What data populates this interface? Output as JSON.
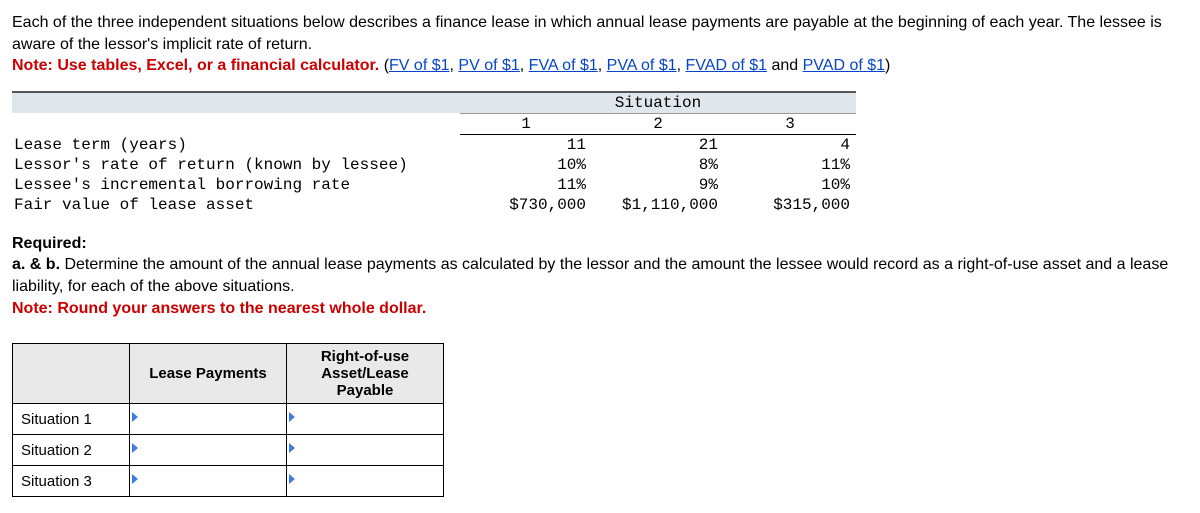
{
  "intro": {
    "line1": "Each of the three independent situations below describes a finance lease in which annual lease payments are payable at the beginning of each year. The lessee is aware of the lessor's implicit rate of return.",
    "note_label": "Note: Use tables, Excel, or a financial calculator.",
    "links": {
      "fv": "FV of $1",
      "pv": "PV of $1",
      "fva": "FVA of $1",
      "pva": "PVA of $1",
      "fvad": "FVAD of $1",
      "pvad": "PVAD of $1"
    },
    "and": " and ",
    "open": " (",
    "sep": ", ",
    "close": ")"
  },
  "sit_table": {
    "super_head": "Situation",
    "col1": "1",
    "col2": "2",
    "col3": "3",
    "rows": {
      "term": {
        "label": "Lease term (years)",
        "v1": "11",
        "v2": "21",
        "v3": "4"
      },
      "lessor_rate": {
        "label": "Lessor's rate of return (known by lessee)",
        "v1": "10%",
        "v2": "8%",
        "v3": "11%"
      },
      "inc_rate": {
        "label": "Lessee's incremental borrowing rate",
        "v1": "11%",
        "v2": "9%",
        "v3": "10%"
      },
      "fv": {
        "label": "Fair value of lease asset",
        "v1": "$730,000",
        "v2": "$1,110,000",
        "v3": "$315,000"
      }
    }
  },
  "required": {
    "title": "Required:",
    "ab": "a. & b.",
    "body": " Determine the amount of the annual lease payments as calculated by the lessor and the amount the lessee would record as a right-of-use asset and a lease liability, for each of the above situations.",
    "note": "Note: Round your answers to the nearest whole dollar."
  },
  "answer": {
    "head_lease": "Lease Payments",
    "head_rou": "Right-of-use Asset/Lease Payable",
    "r1": "Situation 1",
    "r2": "Situation 2",
    "r3": "Situation 3"
  },
  "chart_data": {
    "type": "table",
    "title": "Finance lease situations",
    "columns": [
      "Situation 1",
      "Situation 2",
      "Situation 3"
    ],
    "rows": [
      {
        "label": "Lease term (years)",
        "values": [
          11,
          21,
          4
        ]
      },
      {
        "label": "Lessor's rate of return (known by lessee)",
        "values": [
          "10%",
          "8%",
          "11%"
        ]
      },
      {
        "label": "Lessee's incremental borrowing rate",
        "values": [
          "11%",
          "9%",
          "10%"
        ]
      },
      {
        "label": "Fair value of lease asset",
        "values": [
          "$730,000",
          "$1,110,000",
          "$315,000"
        ]
      }
    ]
  }
}
